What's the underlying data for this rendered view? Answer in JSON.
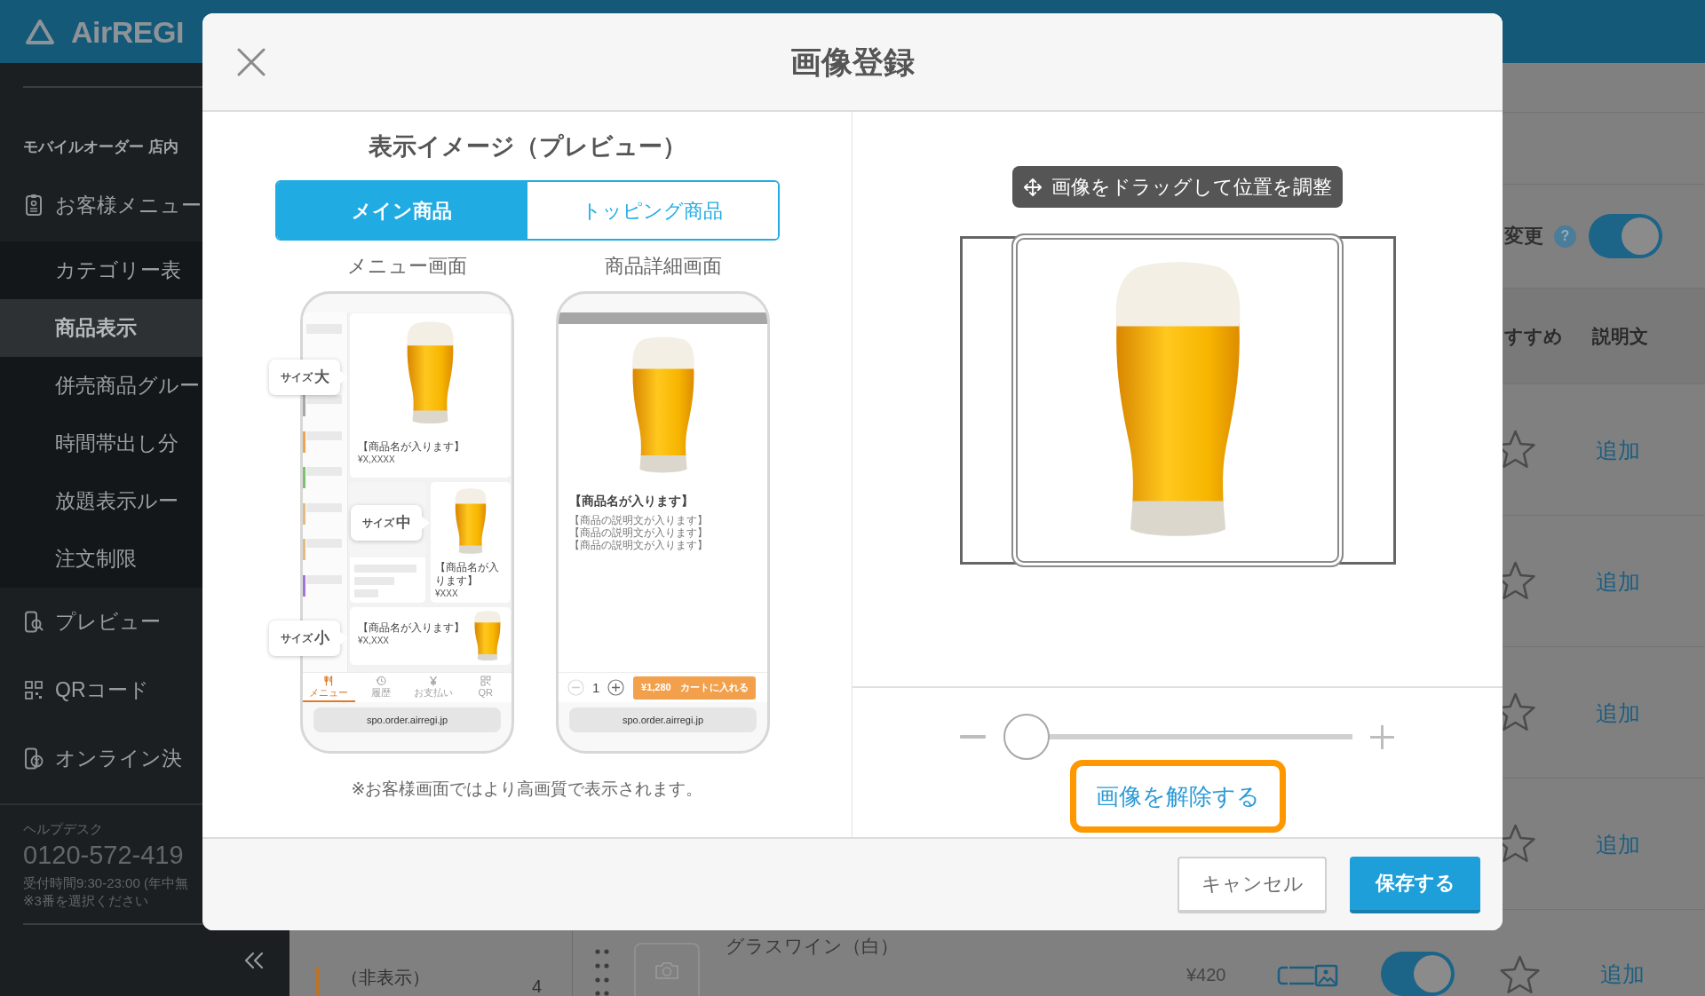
{
  "app": {
    "logo": "AirREGI"
  },
  "sidebar": {
    "section_title": "モバイルオーダー 店内",
    "items": [
      {
        "label": "お客様メニュー",
        "selected": false,
        "children": [
          {
            "label": "カテゴリー表",
            "selected": false
          },
          {
            "label": "商品表示",
            "selected": true
          },
          {
            "label": "併売商品グルー",
            "selected": false
          },
          {
            "label": "時間帯出し分",
            "selected": false
          },
          {
            "label": "放題表示ルー",
            "selected": false
          },
          {
            "label": "注文制限",
            "selected": false
          }
        ]
      },
      {
        "label": "プレビュー",
        "selected": false
      },
      {
        "label": "QRコード",
        "selected": false
      },
      {
        "label": "オンライン決",
        "selected": false
      }
    ],
    "helpdesk": {
      "title": "ヘルプデスク",
      "phone": "0120-572-419",
      "hours": "受付時間9:30-23:00 (年中無",
      "note": "※3番を選択ください"
    }
  },
  "page": {
    "setting": {
      "label": "変更",
      "help": "?",
      "on": true
    },
    "columns": [
      "すすめ",
      "説明文"
    ],
    "rows": [
      {
        "starred": false,
        "description_link": "追加"
      },
      {
        "starred": false,
        "description_link": "追加"
      },
      {
        "starred": false,
        "description_link": "追加"
      },
      {
        "starred": false,
        "description_link": "追加"
      }
    ],
    "category": {
      "label": "（非表示）",
      "count": "4",
      "color": "#b8742c"
    },
    "product": {
      "name": "グラスワイン（白）",
      "price": "¥420",
      "on": true,
      "starred": false,
      "description_link": "追加"
    }
  },
  "dialog": {
    "title": "画像登録",
    "preview": {
      "title": "表示イメージ（プレビュー）",
      "tabs": [
        {
          "label": "メイン商品",
          "selected": true
        },
        {
          "label": "トッピング商品",
          "selected": false
        }
      ],
      "menu_screen": {
        "label": "メニュー画面",
        "categories": [
          {
            "color": "#a8a8a8"
          },
          {
            "color": "#f0a24e"
          },
          {
            "color": "#7cc26a"
          },
          {
            "color": "#e2bb7e"
          },
          {
            "color": "#e2bb7e"
          },
          {
            "color": "#a574d4"
          }
        ],
        "cards": [
          {
            "kind": "large",
            "size_label": "サイズ **大**",
            "name": "【商品名が入ります】",
            "price": "¥X,XXXX"
          },
          {
            "kind": "medium",
            "size_label": "サイズ **中**",
            "name": "【商品名が入ります】",
            "price": "¥XXX"
          },
          {
            "kind": "small",
            "size_label": "サイズ **小**",
            "name": "【商品名が入ります】",
            "price": "¥X,XXX"
          }
        ],
        "tabs": [
          {
            "label": "メニュー",
            "selected": true
          },
          {
            "label": "履歴",
            "selected": false
          },
          {
            "label": "お支払い",
            "selected": false
          },
          {
            "label": "QR",
            "selected": false
          }
        ],
        "url": "spo.order.airregi.jp"
      },
      "detail_screen": {
        "label": "商品詳細画面",
        "name": "【商品名が入ります】",
        "description": [
          "【商品の説明文が入ります】",
          "【商品の説明文が入ります】",
          "【商品の説明文が入ります】"
        ],
        "quantity": "1",
        "price": "¥1,280",
        "cart_label": "カートに入れる",
        "url": "spo.order.airregi.jp"
      },
      "note": "※お客様画面ではより高画質で表示されます。"
    },
    "editor": {
      "hint": "画像をドラッグして位置を調整",
      "zoom_slider": {
        "level": 0
      },
      "remove_button": {
        "label": "画像を解除する",
        "highlighted": true
      }
    },
    "buttons": [
      {
        "label": "キャンセル",
        "kind": "secondary"
      },
      {
        "label": "保存する",
        "kind": "primary"
      }
    ]
  }
}
